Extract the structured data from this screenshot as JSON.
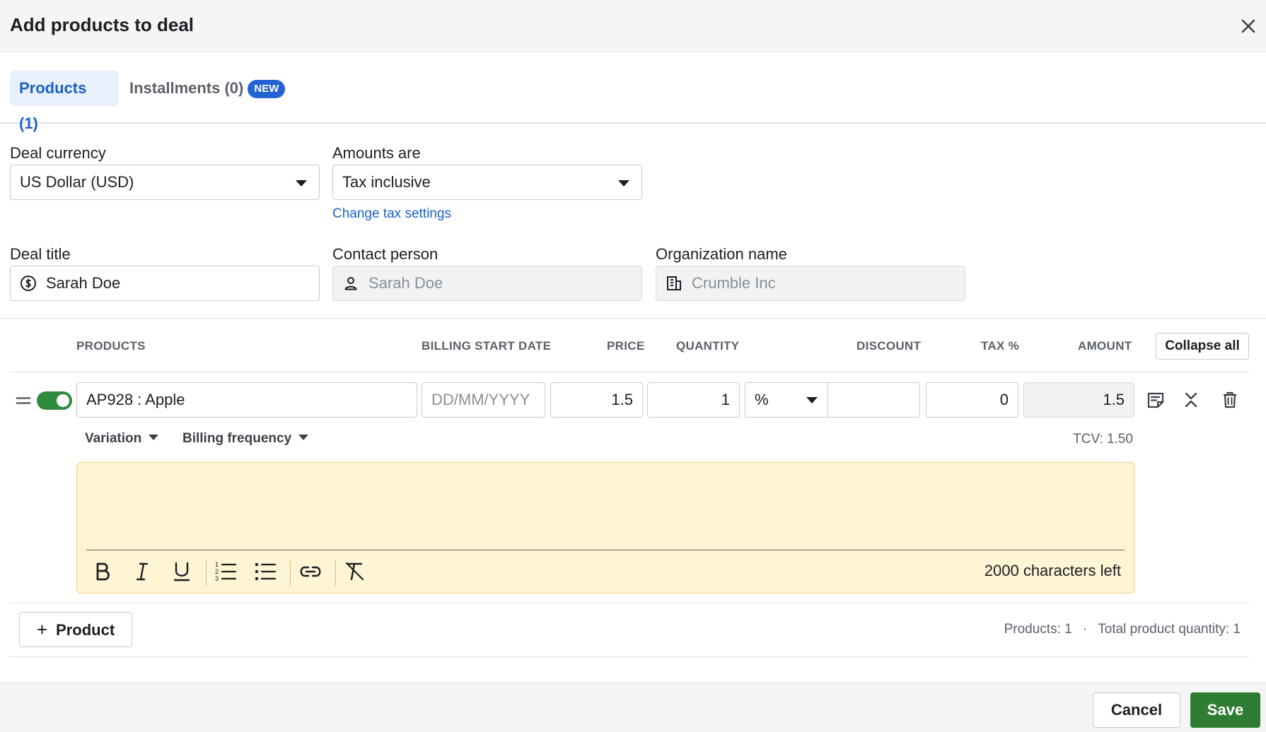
{
  "dialog": {
    "title": "Add products to deal"
  },
  "tabs": [
    {
      "label": "Products (1)"
    },
    {
      "label": "Installments (0)",
      "badge": "NEW"
    }
  ],
  "form": {
    "currency_label": "Deal currency",
    "currency_value": "US Dollar (USD)",
    "amounts_label": "Amounts are",
    "amounts_value": "Tax inclusive",
    "tax_link": "Change tax settings",
    "deal_title_label": "Deal title",
    "deal_title_value": "Sarah Doe",
    "contact_label": "Contact person",
    "contact_value": "Sarah Doe",
    "org_label": "Organization name",
    "org_value": "Crumble Inc"
  },
  "table": {
    "headers": {
      "products": "PRODUCTS",
      "billing_start": "BILLING START DATE",
      "price": "PRICE",
      "quantity": "QUANTITY",
      "discount": "DISCOUNT",
      "tax": "TAX %",
      "amount": "AMOUNT"
    },
    "collapse_label": "Collapse all",
    "row": {
      "enabled": true,
      "product": "AP928 : Apple",
      "billing_placeholder": "DD/MM/YYYY",
      "price": "1.5",
      "quantity": "1",
      "discount_type": "%",
      "discount": "",
      "tax": "0",
      "amount": "1.5",
      "variation_label": "Variation",
      "billing_frequency_label": "Billing frequency",
      "tcv": "TCV: 1.50",
      "note_chars_left": "2000 characters left"
    }
  },
  "summary": {
    "add_product_label": "Product",
    "products_count": "Products: 1",
    "separator": "·",
    "total_quantity": "Total product quantity: 1"
  },
  "footer": {
    "cancel_label": "Cancel",
    "save_label": "Save"
  },
  "colors": {
    "accent": "#1b62c4",
    "badge": "#2463d3",
    "toggle_on": "#2e8b3e",
    "save": "#2e7d32",
    "note_bg": "#fff4d4"
  }
}
